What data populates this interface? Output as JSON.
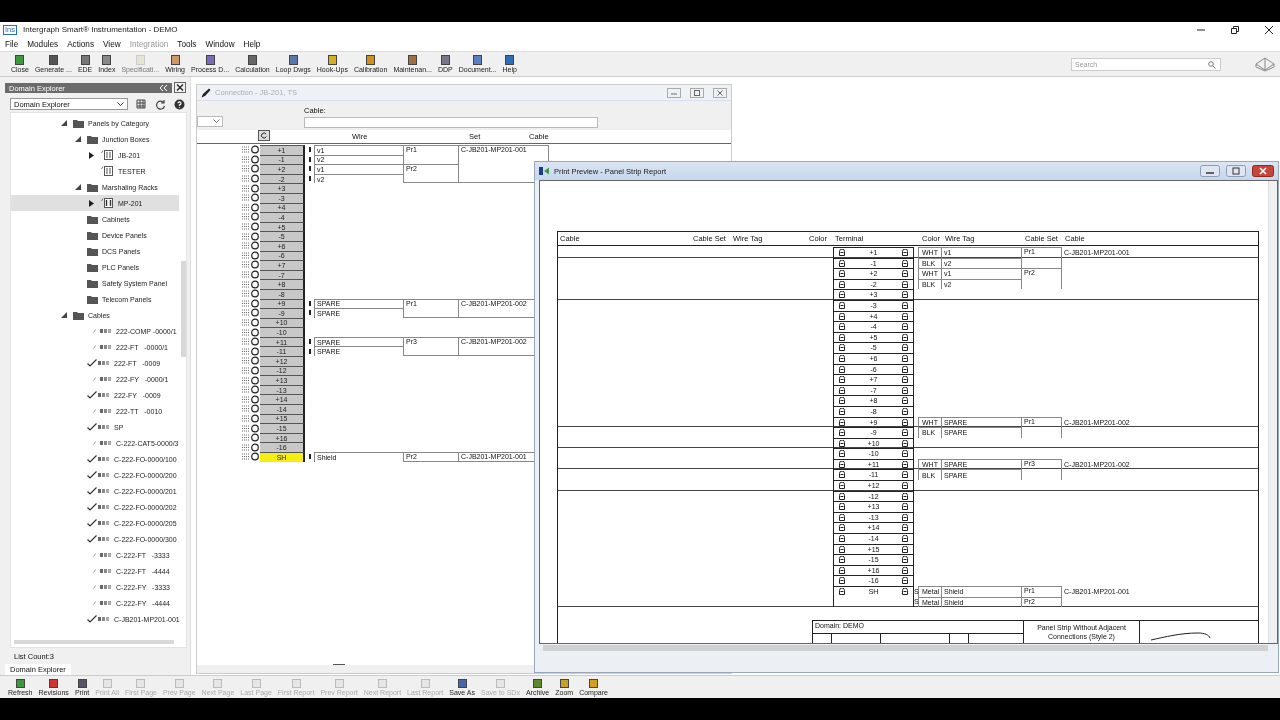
{
  "window": {
    "icon_text": "Ins",
    "title": "Intergraph Smart® Instrumentation - DEMO"
  },
  "menu": [
    {
      "label": "File",
      "disabled": false
    },
    {
      "label": "Modules",
      "disabled": false
    },
    {
      "label": "Actions",
      "disabled": false
    },
    {
      "label": "View",
      "disabled": false
    },
    {
      "label": "Integration",
      "disabled": true
    },
    {
      "label": "Tools",
      "disabled": false
    },
    {
      "label": "Window",
      "disabled": false
    },
    {
      "label": "Help",
      "disabled": false
    }
  ],
  "toolbar": [
    {
      "label": "Close",
      "disabled": false
    },
    {
      "label": "Generate ...",
      "disabled": false
    },
    {
      "label": "EDE",
      "disabled": false
    },
    {
      "label": "Index",
      "disabled": false
    },
    {
      "label": "Specificati...",
      "disabled": true
    },
    {
      "label": "Wiring",
      "disabled": false
    },
    {
      "label": "Process D...",
      "disabled": false
    },
    {
      "label": "Calculation",
      "disabled": false
    },
    {
      "label": "Loop Dwgs",
      "disabled": false
    },
    {
      "label": "Hook-Ups",
      "disabled": false
    },
    {
      "label": "Calibration",
      "disabled": false
    },
    {
      "label": "Maintenan...",
      "disabled": false
    },
    {
      "label": "DDP",
      "disabled": false
    },
    {
      "label": "Document...",
      "disabled": false
    },
    {
      "label": "Help",
      "disabled": false
    }
  ],
  "search": {
    "placeholder": "Search"
  },
  "domain_explorer": {
    "title": "Domain Explorer",
    "dropdown": "Domain Explorer",
    "tree": [
      {
        "label": "Panels by Category",
        "kind": "folder",
        "expanded": true,
        "selected": false,
        "children": [
          {
            "label": "Junction Boxes",
            "kind": "folder",
            "expanded": true,
            "selected": false,
            "children": [
              {
                "label": "JB-201",
                "kind": "panel",
                "expanded": false,
                "selected": false
              },
              {
                "label": "TESTER",
                "kind": "panel",
                "selected": false
              }
            ]
          },
          {
            "label": "Marshaling Racks",
            "kind": "folder",
            "expanded": true,
            "selected": false,
            "children": [
              {
                "label": "MP-201",
                "kind": "rack",
                "expanded": false,
                "selected": true
              }
            ]
          },
          {
            "label": "Cabinets",
            "kind": "folder",
            "selected": false
          },
          {
            "label": "Device Panels",
            "kind": "folder",
            "selected": false
          },
          {
            "label": "DCS Panels",
            "kind": "folder",
            "selected": false
          },
          {
            "label": "PLC Panels",
            "kind": "folder",
            "selected": false
          },
          {
            "label": "Safety System Panel",
            "kind": "folder",
            "selected": false
          },
          {
            "label": "Telecom Panels",
            "kind": "folder",
            "selected": false
          }
        ]
      },
      {
        "label": "Cables",
        "kind": "folder",
        "expanded": true,
        "selected": false,
        "children": [
          {
            "label": "222-COMP -0000/1",
            "kind": "cable",
            "checked": false,
            "selected": false
          },
          {
            "label": "222-FT   -0000/1",
            "kind": "cable",
            "checked": false,
            "selected": false
          },
          {
            "label": "222-FT   -0009",
            "kind": "cable",
            "checked": true,
            "selected": false
          },
          {
            "label": "222-FY   -0000/1",
            "kind": "cable",
            "checked": false,
            "selected": false
          },
          {
            "label": "222-FY   -0009",
            "kind": "cable",
            "checked": true,
            "selected": false
          },
          {
            "label": "222-TT   -0010",
            "kind": "cable",
            "checked": false,
            "selected": false
          },
          {
            "label": "SP",
            "kind": "cable",
            "checked": true,
            "selected": false
          },
          {
            "label": "C-222-CAT5-0000/3",
            "kind": "cable",
            "checked": false,
            "selected": false
          },
          {
            "label": "C-222-FO-0000/100",
            "kind": "cable",
            "checked": true,
            "selected": false
          },
          {
            "label": "C-222-FO-0000/200",
            "kind": "cable",
            "checked": true,
            "selected": false
          },
          {
            "label": "C-222-FO-0000/201",
            "kind": "cable",
            "checked": true,
            "selected": false
          },
          {
            "label": "C-222-FO-0000/202",
            "kind": "cable",
            "checked": true,
            "selected": false
          },
          {
            "label": "C-222-FO-0000/205",
            "kind": "cable",
            "checked": true,
            "selected": false
          },
          {
            "label": "C-222-FO-0000/300",
            "kind": "cable",
            "checked": true,
            "selected": false
          },
          {
            "label": "C-222-FT   -3333",
            "kind": "cable",
            "checked": false,
            "selected": false
          },
          {
            "label": "C-222-FT   -4444",
            "kind": "cable",
            "checked": false,
            "selected": false
          },
          {
            "label": "C-222-FY   -3333",
            "kind": "cable",
            "checked": false,
            "selected": false
          },
          {
            "label": "C-222-FY   -4444",
            "kind": "cable",
            "checked": false,
            "selected": false
          },
          {
            "label": "C-JB201-MP201-001",
            "kind": "cable",
            "checked": true,
            "selected": false
          }
        ]
      }
    ],
    "list_count": "List Count:3",
    "tab": "Domain Explorer"
  },
  "connection_window": {
    "title": "Connection - JB-201, TS",
    "cable_label": "Cable:",
    "columns": [
      "Wire",
      "Set",
      "Cable"
    ],
    "terminals": [
      {
        "label": "+1",
        "selected": false,
        "wire": "v1",
        "pair": "Pr1",
        "cable": "C-JB201-MP201-001"
      },
      {
        "label": "-1",
        "selected": false,
        "wire": "v2"
      },
      {
        "label": "+2",
        "selected": false,
        "wire": "v1",
        "pair": "Pr2"
      },
      {
        "label": "-2",
        "selected": false,
        "wire": "v2"
      },
      {
        "label": "+3",
        "selected": false
      },
      {
        "label": "-3",
        "selected": false
      },
      {
        "label": "+4",
        "selected": false
      },
      {
        "label": "-4",
        "selected": false
      },
      {
        "label": "+5",
        "selected": false
      },
      {
        "label": "-5",
        "selected": false
      },
      {
        "label": "+6",
        "selected": false
      },
      {
        "label": "-6",
        "selected": false
      },
      {
        "label": "+7",
        "selected": false
      },
      {
        "label": "-7",
        "selected": false
      },
      {
        "label": "+8",
        "selected": false
      },
      {
        "label": "-8",
        "selected": false
      },
      {
        "label": "+9",
        "selected": false,
        "wire": "SPARE",
        "pair": "Pr1",
        "cable": "C-JB201-MP201-002"
      },
      {
        "label": "-9",
        "selected": false,
        "wire": "SPARE"
      },
      {
        "label": "+10",
        "selected": false
      },
      {
        "label": "-10",
        "selected": false
      },
      {
        "label": "+11",
        "selected": false,
        "wire": "SPARE",
        "pair": "Pr3",
        "cable": "C-JB201-MP201-002"
      },
      {
        "label": "-11",
        "selected": false,
        "wire": "SPARE"
      },
      {
        "label": "+12",
        "selected": false
      },
      {
        "label": "-12",
        "selected": false
      },
      {
        "label": "+13",
        "selected": false
      },
      {
        "label": "-13",
        "selected": false
      },
      {
        "label": "+14",
        "selected": false
      },
      {
        "label": "-14",
        "selected": false
      },
      {
        "label": "+15",
        "selected": false
      },
      {
        "label": "-15",
        "selected": false
      },
      {
        "label": "+16",
        "selected": false
      },
      {
        "label": "-16",
        "selected": false
      },
      {
        "label": "SH",
        "selected": true,
        "wire": "Shield",
        "pair": "Pr2",
        "cable": "C-JB201-MP201-001"
      }
    ]
  },
  "print_preview": {
    "title": "Print Preview - Panel Strip Report",
    "left_columns": [
      "Cable",
      "Cable Set",
      "Wire Tag",
      "Color",
      "Terminal"
    ],
    "right_columns": [
      "Color",
      "Wire Tag",
      "Cable Set",
      "Cable"
    ],
    "terminals": [
      {
        "label": "+1",
        "wires": [
          {
            "code": "WHT",
            "tag": "v1",
            "pair": "Pr1"
          }
        ],
        "cable": "C-JB201-MP201-001"
      },
      {
        "label": "-1",
        "wires": [
          {
            "code": "BLK",
            "tag": "v2"
          }
        ]
      },
      {
        "label": "+2",
        "wires": [
          {
            "code": "WHT",
            "tag": "v1",
            "pair": "Pr2"
          }
        ]
      },
      {
        "label": "-2",
        "wires": [
          {
            "code": "BLK",
            "tag": "v2"
          }
        ]
      },
      {
        "label": "+3"
      },
      {
        "label": "-3"
      },
      {
        "label": "+4"
      },
      {
        "label": "-4"
      },
      {
        "label": "+5"
      },
      {
        "label": "-5"
      },
      {
        "label": "+6"
      },
      {
        "label": "-6"
      },
      {
        "label": "+7"
      },
      {
        "label": "-7"
      },
      {
        "label": "+8"
      },
      {
        "label": "-8"
      },
      {
        "label": "+9",
        "wires": [
          {
            "code": "WHT",
            "tag": "SPARE",
            "pair": "Pr1"
          }
        ],
        "cable": "C-JB201-MP201-002"
      },
      {
        "label": "-9",
        "wires": [
          {
            "code": "BLK",
            "tag": "SPARE"
          }
        ]
      },
      {
        "label": "+10"
      },
      {
        "label": "-10"
      },
      {
        "label": "+11",
        "wires": [
          {
            "code": "WHT",
            "tag": "SPARE",
            "pair": "Pr3"
          }
        ],
        "cable": "C-JB201-MP201-002"
      },
      {
        "label": "-11",
        "wires": [
          {
            "code": "BLK",
            "tag": "SPARE"
          }
        ]
      },
      {
        "label": "+12"
      },
      {
        "label": "-12"
      },
      {
        "label": "+13"
      },
      {
        "label": "-13"
      },
      {
        "label": "+14"
      },
      {
        "label": "-14"
      },
      {
        "label": "+15"
      },
      {
        "label": "-15"
      },
      {
        "label": "+16"
      },
      {
        "label": "-16"
      },
      {
        "label": "SH",
        "wires": [
          {
            "marker": "S",
            "code": "Metal",
            "tag": "Shield",
            "pair": "Pr1"
          },
          {
            "marker": "S",
            "code": "Metal",
            "tag": "Shield",
            "pair": "Pr2"
          }
        ],
        "cable": "C-JB201-MP201-001"
      }
    ],
    "title_block": {
      "domain": "Domain: DEMO",
      "report_title": "Panel Strip Without Adjacent Connections (Style 2)"
    }
  },
  "bottom_toolbar": [
    {
      "label": "Refresh",
      "disabled": false
    },
    {
      "label": "Revisions",
      "disabled": false
    },
    {
      "label": "Print",
      "disabled": false
    },
    {
      "label": "Print All",
      "disabled": true
    },
    {
      "label": "First Page",
      "disabled": true
    },
    {
      "label": "Prev Page",
      "disabled": true
    },
    {
      "label": "Next Page",
      "disabled": true
    },
    {
      "label": "Last Page",
      "disabled": true
    },
    {
      "label": "First Report",
      "disabled": true
    },
    {
      "label": "Prev Report",
      "disabled": true
    },
    {
      "label": "Next Report",
      "disabled": true
    },
    {
      "label": "Last Report",
      "disabled": true
    },
    {
      "label": "Save As",
      "disabled": false
    },
    {
      "label": "Save to SDx",
      "disabled": true
    },
    {
      "label": "Archive",
      "disabled": false
    },
    {
      "label": "Zoom",
      "disabled": false
    },
    {
      "label": "Compare",
      "disabled": false
    }
  ]
}
